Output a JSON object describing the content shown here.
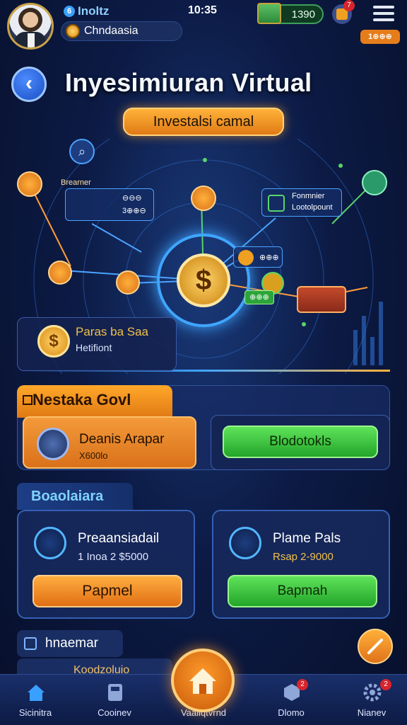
{
  "header": {
    "username": "Inoltz",
    "level_badge": "6",
    "balance_label": "Chndaasia",
    "time": "10:35",
    "money": "1390",
    "gift_badge": "7",
    "small_badge": "1⊕⊕⊕"
  },
  "page": {
    "title": "Inyesimiuran Virtual",
    "subtitle": "Investalsi camal"
  },
  "hero": {
    "info_left_title": "Brearner",
    "info_left_rows": [
      "⊖⊖⊖",
      "3⊕⊕⊖"
    ],
    "info_right_title": "Fonmnier",
    "info_right_sub": "Lootolpount",
    "node_small_label": "⊕⊕⊕",
    "node_green_label": "⊕⊕⊕",
    "left_card_title": "Paras ba Saa",
    "left_card_sub": "Hetifiont"
  },
  "section_main": {
    "tab_label": "Nestaka Govl",
    "option1_title": "Deanis Arapar",
    "option1_sub": "X600lo",
    "option2_button": "Blodotokls"
  },
  "section_secondary": {
    "tab_label": "Boaolaiara",
    "card1_title": "Preaansiadail",
    "card1_sub": "1 Inoa 2 $5000",
    "card1_button": "Papmel",
    "card2_title": "Plame Pals",
    "card2_sub": "Rsap 2-9000",
    "card2_button": "Bapmah"
  },
  "section_third": {
    "tab_label": "hnaemar",
    "peek_label": "Koodzoluio"
  },
  "nav": {
    "item1": "Sicinitra",
    "item2": "Cooinev",
    "item3": "Vaaliqtvrnd",
    "item4": "Dlomo",
    "item5": "Nianev",
    "badge4": "2",
    "badge5": "2"
  },
  "colors": {
    "accent_orange": "#e8861e",
    "accent_green": "#34b83a",
    "accent_blue": "#2c7bff",
    "background": "#0c1a44"
  }
}
